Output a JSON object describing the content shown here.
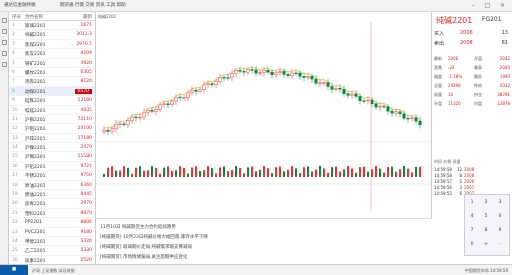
{
  "titlebar": {
    "app_title": "通达信金融终端",
    "subtitle": "期货通 行情 交易 资讯 工具 帮助"
  },
  "sidebar": {
    "col_idx": "序号",
    "col_name": "合约名称",
    "col_price": "最新",
    "rows": [
      {
        "idx": "1",
        "name": "玻璃2201",
        "price": "1671"
      },
      {
        "idx": "2",
        "name": "纯碱2201",
        "price": "3011.3"
      },
      {
        "idx": "3",
        "name": "焦煤2201",
        "price": "2970.5"
      },
      {
        "idx": "4",
        "name": "焦炭2201",
        "price": "4209"
      },
      {
        "idx": "5",
        "name": "铁矿2201",
        "price": "4920"
      },
      {
        "idx": "6",
        "name": "螺纹2201",
        "price": "6305"
      },
      {
        "idx": "7",
        "name": "热卷2201",
        "price": "8120"
      },
      {
        "idx": "8",
        "name": "动煤2201",
        "price": "6570"
      },
      {
        "idx": "9",
        "name": "硅铁2201",
        "price": "12180"
      },
      {
        "idx": "10",
        "name": "锰硅2201",
        "price": "4935"
      },
      {
        "idx": "11",
        "name": "沪铜2201",
        "price": "72110"
      },
      {
        "idx": "12",
        "name": "沪铝2201",
        "price": "20100"
      },
      {
        "idx": "13",
        "name": "沪锌2201",
        "price": "17180"
      },
      {
        "idx": "14",
        "name": "沪镍2201",
        "price": "2470"
      },
      {
        "idx": "15",
        "name": "沪锡2201",
        "price": "15580"
      },
      {
        "idx": "16",
        "name": "沪铅2201",
        "price": "9721"
      },
      {
        "idx": "17",
        "name": "不锈2201",
        "price": "9750"
      },
      {
        "idx": "18",
        "name": "原油2201",
        "price": "6360"
      },
      {
        "idx": "19",
        "name": "燃油2201",
        "price": "8445"
      },
      {
        "idx": "20",
        "name": "沥青2201",
        "price": "2970"
      },
      {
        "idx": "21",
        "name": "塑料2201",
        "price": "8870"
      },
      {
        "idx": "22",
        "name": "PP2201",
        "price": "8806"
      },
      {
        "idx": "23",
        "name": "PVC2201",
        "price": "9180"
      },
      {
        "idx": "24",
        "name": "甲醇2201",
        "price": "3320"
      },
      {
        "idx": "25",
        "name": "乙二2201",
        "price": "5330"
      },
      {
        "idx": "26",
        "name": "尿素2201",
        "price": "2520"
      }
    ]
  },
  "chart": {
    "symbol": "纯碱2201"
  },
  "info": {
    "line1": "11月10日 纯碱期货主力合约延续跌势",
    "line2": "[纯碱期货] 10月23日纯碱价格大幅回落,库存水平下降",
    "line3": "[纯碱期货] 玻璃期价走弱,纯碱需求端支撑减弱",
    "line4": "[纯碱期货] 市场情绪偏弱,关注后期供应变化"
  },
  "right": {
    "title": "纯碱2201",
    "code": "FG201",
    "sell_label": "卖出",
    "sell_price": "2008",
    "sell_vol": "81",
    "buy_label": "买入",
    "buy_price": "2006",
    "buy_vol": "13",
    "quotes": [
      {
        "k": "最新",
        "v": "2008",
        "k2": "开盘",
        "v2": "2032"
      },
      {
        "k": "涨跌",
        "v": "-24",
        "k2": "最高",
        "v2": "2040"
      },
      {
        "k": "幅度",
        "v": "-1.18%",
        "k2": "最低",
        "v2": "1990"
      },
      {
        "k": "总量",
        "v": "24198",
        "k2": "昨结",
        "v2": "2032"
      },
      {
        "k": "现量",
        "v": "16",
        "k2": "持仓",
        "v2": "38291"
      },
      {
        "k": "外盘",
        "v": "11320",
        "k2": "内盘",
        "v2": "12878"
      }
    ],
    "tick_header": "时间 价格 现量",
    "ticks": [
      {
        "t": "14:59:59",
        "p": "2008",
        "v": "12"
      },
      {
        "t": "14:59:58",
        "p": "2008",
        "v": "8"
      },
      {
        "t": "14:59:57",
        "p": "2006",
        "v": "5"
      },
      {
        "t": "14:59:56",
        "p": "2007",
        "v": "3"
      },
      {
        "t": "14:59:55",
        "p": "2007",
        "v": "6"
      }
    ],
    "pad_keys": [
      "1",
      "2",
      "3",
      "4",
      "5",
      "6",
      "7",
      "8",
      "9",
      "0",
      "+",
      "-"
    ]
  },
  "taskbar": {
    "left": "沪深 上证指数 深证成指",
    "right": "中国期货市场 14:59:59"
  }
}
